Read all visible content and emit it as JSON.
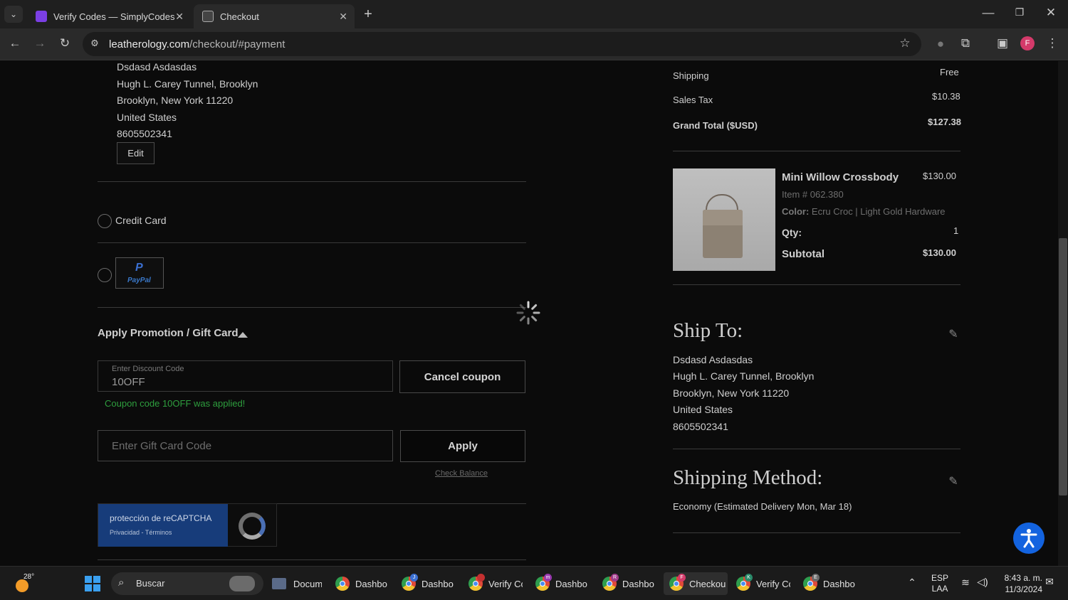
{
  "browser": {
    "tabs": [
      {
        "title": "Verify Codes — SimplyCodes",
        "active": false
      },
      {
        "title": "Checkout",
        "active": true
      }
    ],
    "url_host": "leatherology.com",
    "url_path": "/checkout/#payment",
    "profile_initial": "F"
  },
  "billing": {
    "name": "Dsdasd Asdasdas",
    "street": "Hugh L. Carey Tunnel, Brooklyn",
    "city": "Brooklyn, New York 11220",
    "country": "United States",
    "phone": "8605502341",
    "edit_label": "Edit"
  },
  "payment": {
    "credit_card_label": "Credit Card",
    "paypal_label": "PayPal"
  },
  "promo": {
    "section_title": "Apply Promotion / Gift Card",
    "discount_label": "Enter Discount Code",
    "discount_value": "10OFF",
    "cancel_label": "Cancel coupon",
    "applied_msg": "Coupon code 10OFF was applied!",
    "gift_placeholder": "Enter Gift Card Code",
    "apply_label": "Apply",
    "check_balance": "Check Balance"
  },
  "recaptcha": {
    "title": "protección de reCAPTCHA",
    "links": "Privacidad - Términos"
  },
  "summary": {
    "shipping_label": "Shipping",
    "shipping_value": "Free",
    "tax_label": "Sales Tax",
    "tax_value": "$10.38",
    "grand_label": "Grand Total ($USD)",
    "grand_value": "$127.38"
  },
  "item": {
    "name": "Mini Willow Crossbody",
    "price": "$130.00",
    "sku": "Item # 062.380",
    "color_label": "Color:",
    "color_value": "Ecru Croc | Light Gold Hardware",
    "qty_label": "Qty:",
    "qty_value": "1",
    "subtotal_label": "Subtotal",
    "subtotal_value": "$130.00"
  },
  "ship_to": {
    "title": "Ship To:",
    "name": "Dsdasd Asdasdas",
    "street": "Hugh L. Carey Tunnel, Brooklyn",
    "city": "Brooklyn, New York 11220",
    "country": "United States",
    "phone": "8605502341"
  },
  "shipping_method": {
    "title": "Shipping Method:",
    "value": "Economy (Estimated Delivery Mon, Mar 18)"
  },
  "taskbar": {
    "weather_temp": "28°",
    "search_label": "Buscar",
    "apps": [
      {
        "label": "Docum",
        "badge": ""
      },
      {
        "label": "Dashbo",
        "badge": ""
      },
      {
        "label": "Dashbo",
        "badge": "J"
      },
      {
        "label": "Verify Cc",
        "badge": ""
      },
      {
        "label": "Dashbo",
        "badge": "m"
      },
      {
        "label": "Dashbo",
        "badge": "R"
      },
      {
        "label": "Checkou",
        "badge": "F"
      },
      {
        "label": "Verify Cc",
        "badge": "K"
      },
      {
        "label": "Dashbo",
        "badge": "E"
      }
    ],
    "lang_top": "ESP",
    "lang_bottom": "LAA",
    "time": "8:43 a. m.",
    "date": "11/3/2024"
  },
  "colors": {
    "success": "#2e9e3e",
    "accessibility": "#1363df",
    "active_tab": "#2a2a2a"
  }
}
